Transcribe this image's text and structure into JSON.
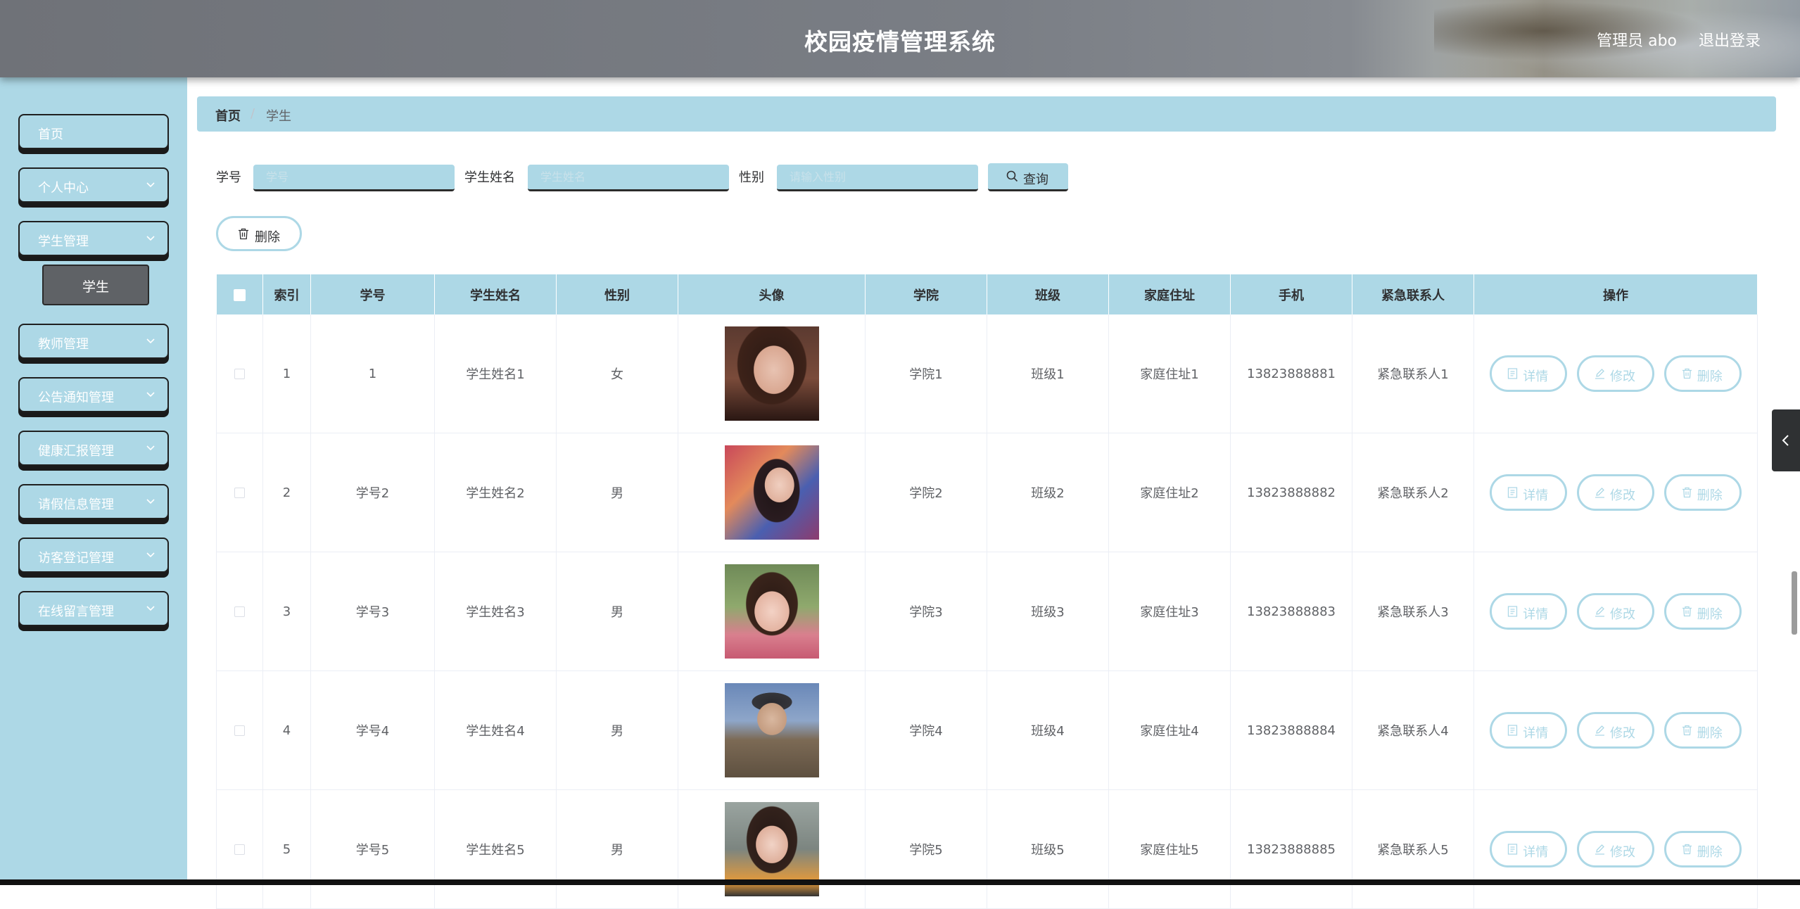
{
  "header": {
    "title": "校园疫情管理系统",
    "admin_text": "管理员 abo",
    "logout_label": "退出登录"
  },
  "sidebar": {
    "items": [
      {
        "label": "首页",
        "has_arrow": false
      },
      {
        "label": "个人中心",
        "has_arrow": true
      },
      {
        "label": "学生管理",
        "has_arrow": true
      },
      {
        "label": "教师管理",
        "has_arrow": true
      },
      {
        "label": "公告通知管理",
        "has_arrow": true
      },
      {
        "label": "健康汇报管理",
        "has_arrow": true
      },
      {
        "label": "请假信息管理",
        "has_arrow": true
      },
      {
        "label": "访客登记管理",
        "has_arrow": true
      },
      {
        "label": "在线留言管理",
        "has_arrow": true
      }
    ],
    "active_sub_item": "学生"
  },
  "breadcrumb": {
    "home": "首页",
    "separator": "/",
    "current": "学生"
  },
  "filters": {
    "student_no_label": "学号",
    "student_no_placeholder": "学号",
    "student_name_label": "学生姓名",
    "student_name_placeholder": "学生姓名",
    "gender_label": "性别",
    "gender_placeholder": "请输入性别",
    "query_label": "查询"
  },
  "actions": {
    "delete_label": "删除"
  },
  "table": {
    "columns": [
      "索引",
      "学号",
      "学生姓名",
      "性别",
      "头像",
      "学院",
      "班级",
      "家庭住址",
      "手机",
      "紧急联系人",
      "操作"
    ],
    "rows": [
      {
        "index": "1",
        "student_no": "1",
        "name": "学生姓名1",
        "gender": "女",
        "college": "学院1",
        "class": "班级1",
        "address": "家庭住址1",
        "phone": "13823888881",
        "contact": "紧急联系人1"
      },
      {
        "index": "2",
        "student_no": "学号2",
        "name": "学生姓名2",
        "gender": "男",
        "college": "学院2",
        "class": "班级2",
        "address": "家庭住址2",
        "phone": "13823888882",
        "contact": "紧急联系人2"
      },
      {
        "index": "3",
        "student_no": "学号3",
        "name": "学生姓名3",
        "gender": "男",
        "college": "学院3",
        "class": "班级3",
        "address": "家庭住址3",
        "phone": "13823888883",
        "contact": "紧急联系人3"
      },
      {
        "index": "4",
        "student_no": "学号4",
        "name": "学生姓名4",
        "gender": "男",
        "college": "学院4",
        "class": "班级4",
        "address": "家庭住址4",
        "phone": "13823888884",
        "contact": "紧急联系人4"
      },
      {
        "index": "5",
        "student_no": "学号5",
        "name": "学生姓名5",
        "gender": "男",
        "college": "学院5",
        "class": "班级5",
        "address": "家庭住址5",
        "phone": "13823888885",
        "contact": "紧急联系人5"
      }
    ],
    "row_actions": {
      "detail": "详情",
      "edit": "修改",
      "delete": "删除"
    }
  },
  "colors": {
    "accent": "#add8e6",
    "header_bg": "#7a7e85",
    "submenu_active_bg": "#5f6266"
  }
}
